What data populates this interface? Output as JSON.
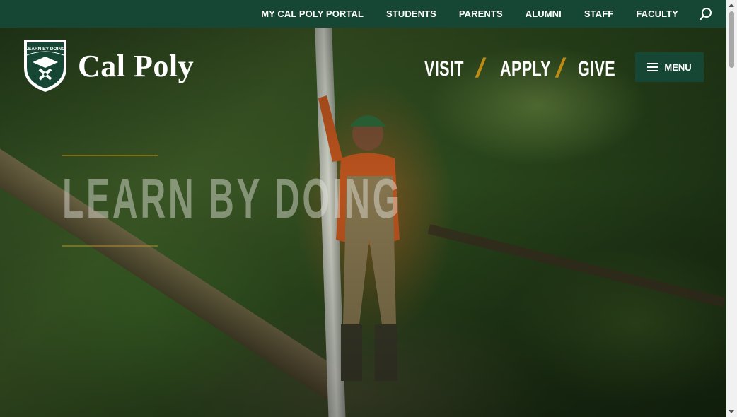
{
  "topbar": {
    "links": [
      "MY CAL POLY PORTAL",
      "STUDENTS",
      "PARENTS",
      "ALUMNI",
      "STAFF",
      "FACULTY"
    ],
    "search_icon": "search-icon"
  },
  "logo": {
    "seal_text": "LEARN BY DOING",
    "wordmark": "Cal Poly"
  },
  "cta": {
    "visit": "VISIT",
    "apply": "APPLY",
    "give": "GIVE",
    "divider": "/"
  },
  "menu": {
    "label": "MENU",
    "icon": "hamburger-icon"
  },
  "hero": {
    "tagline": "LEARN BY DOING"
  },
  "colors": {
    "brand_green": "#154734",
    "gold": "#bd8b13"
  }
}
